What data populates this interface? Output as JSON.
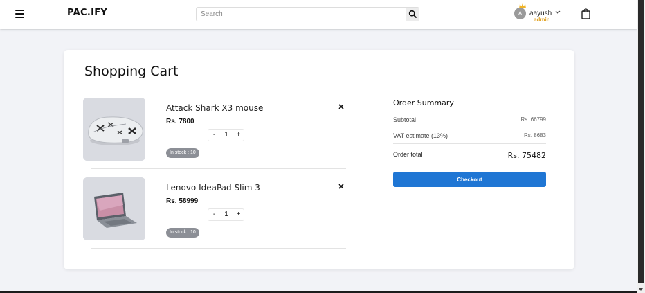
{
  "header": {
    "logo": "PAC.IFY",
    "search_placeholder": "Search",
    "user": {
      "initial": "A",
      "name": "aayush",
      "role": "admin"
    }
  },
  "cart": {
    "title": "Shopping Cart",
    "items": [
      {
        "name": "Attack Shark X3 mouse",
        "price": "Rs. 7800",
        "quantity": "1",
        "stock": "In stock : 10"
      },
      {
        "name": "Lenovo IdeaPad Slim 3",
        "price": "Rs. 58999",
        "quantity": "1",
        "stock": "In stock : 10"
      }
    ],
    "qty_minus": "-",
    "qty_plus": "+"
  },
  "summary": {
    "title": "Order Summary",
    "subtotal_label": "Subtotal",
    "subtotal_value": "Rs. 66799",
    "vat_label": "VAT estimate (13%)",
    "vat_value": "Rs. 8683",
    "total_label": "Order total",
    "total_value": "Rs. 75482",
    "checkout_label": "Checkout"
  },
  "colors": {
    "accent": "#1f76d4",
    "role": "#e2a52a",
    "stock_badge": "#8c8f96"
  }
}
